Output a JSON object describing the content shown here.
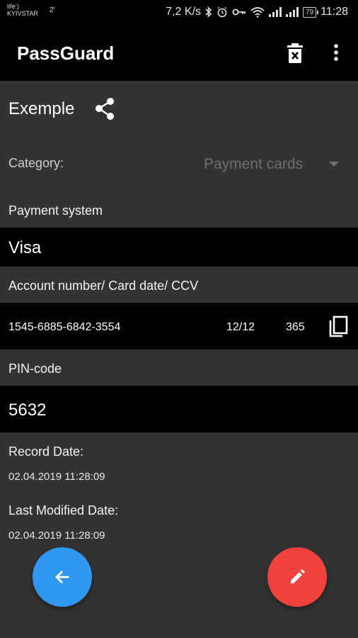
{
  "status_bar": {
    "carrier_line1": "life:)",
    "carrier_line2": "KYIVSTAR",
    "superscript": "2'",
    "speed": "7,2 K/s",
    "battery": "79",
    "time": "11:28"
  },
  "app_bar": {
    "title": "PassGuard",
    "delete_icon": "delete-x-icon",
    "more_icon": "more-vert-icon"
  },
  "record": {
    "name": "Exemple",
    "share_icon": "share-icon"
  },
  "category": {
    "label": "Category:",
    "value": "Payment cards"
  },
  "payment_system": {
    "label": "Payment system",
    "value": "Visa"
  },
  "card": {
    "label": "Account number/ Card date/ CCV",
    "number": "1545-6885-6842-3554",
    "date": "12/12",
    "ccv": "365",
    "copy_icon": "copy-icon"
  },
  "pin": {
    "label": "PIN-code",
    "value": "5632"
  },
  "record_date": {
    "label": "Record Date:",
    "value": "02.04.2019 11:28:09"
  },
  "modified_date": {
    "label": "Last Modified Date:",
    "value": "02.04.2019 11:28:09"
  },
  "fabs": {
    "back_icon": "arrow-back-icon",
    "edit_icon": "pencil-icon"
  },
  "colors": {
    "background": "#333333",
    "band": "#000000",
    "fab_back": "#2f97f0",
    "fab_edit": "#f0413d"
  }
}
